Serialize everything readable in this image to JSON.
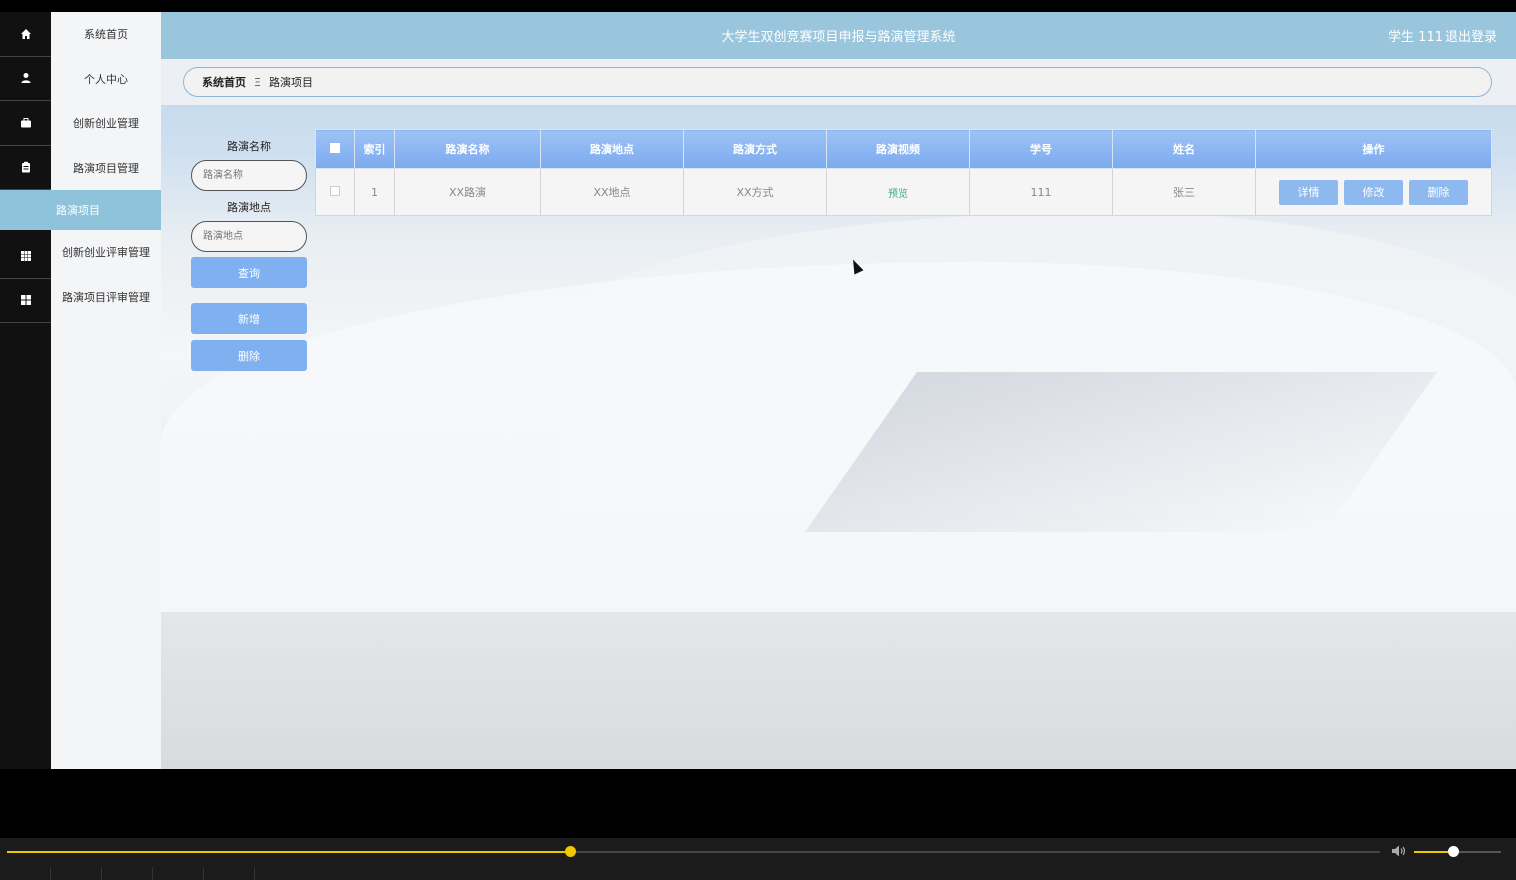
{
  "header": {
    "title": "大学生双创竞赛项目申报与路演管理系统",
    "user": "学生 111",
    "logout": "退出登录"
  },
  "sidebar": {
    "items": [
      {
        "label": "系统首页",
        "icon": "home-icon"
      },
      {
        "label": "个人中心",
        "icon": "user-icon"
      },
      {
        "label": "创新创业管理",
        "icon": "briefcase-icon"
      },
      {
        "label": "路演项目管理",
        "icon": "clipboard-icon"
      },
      {
        "label": "创新创业评审管理",
        "icon": "grid-icon"
      },
      {
        "label": "路演项目评审管理",
        "icon": "apps-icon"
      }
    ],
    "active_sub": "路演项目"
  },
  "breadcrumb": {
    "home": "系统首页",
    "separator": "Ξ",
    "current": "路演项目"
  },
  "search": {
    "name_label": "路演名称",
    "name_placeholder": "路演名称",
    "place_label": "路演地点",
    "place_placeholder": "路演地点",
    "query": "查询",
    "add": "新增",
    "delete": "删除"
  },
  "table": {
    "headers": [
      "索引",
      "路演名称",
      "路演地点",
      "路演方式",
      "路演视频",
      "学号",
      "姓名",
      "操作"
    ],
    "rows": [
      {
        "index": "1",
        "name": "XX路演",
        "place": "XX地点",
        "method": "XX方式",
        "video": "预览",
        "student_id": "111",
        "student_name": "张三"
      }
    ],
    "actions": {
      "detail": "详情",
      "edit": "修改",
      "delete": "删除"
    }
  },
  "player": {
    "progress": 0.41,
    "volume": 0.45,
    "accent": "#f0c800"
  }
}
